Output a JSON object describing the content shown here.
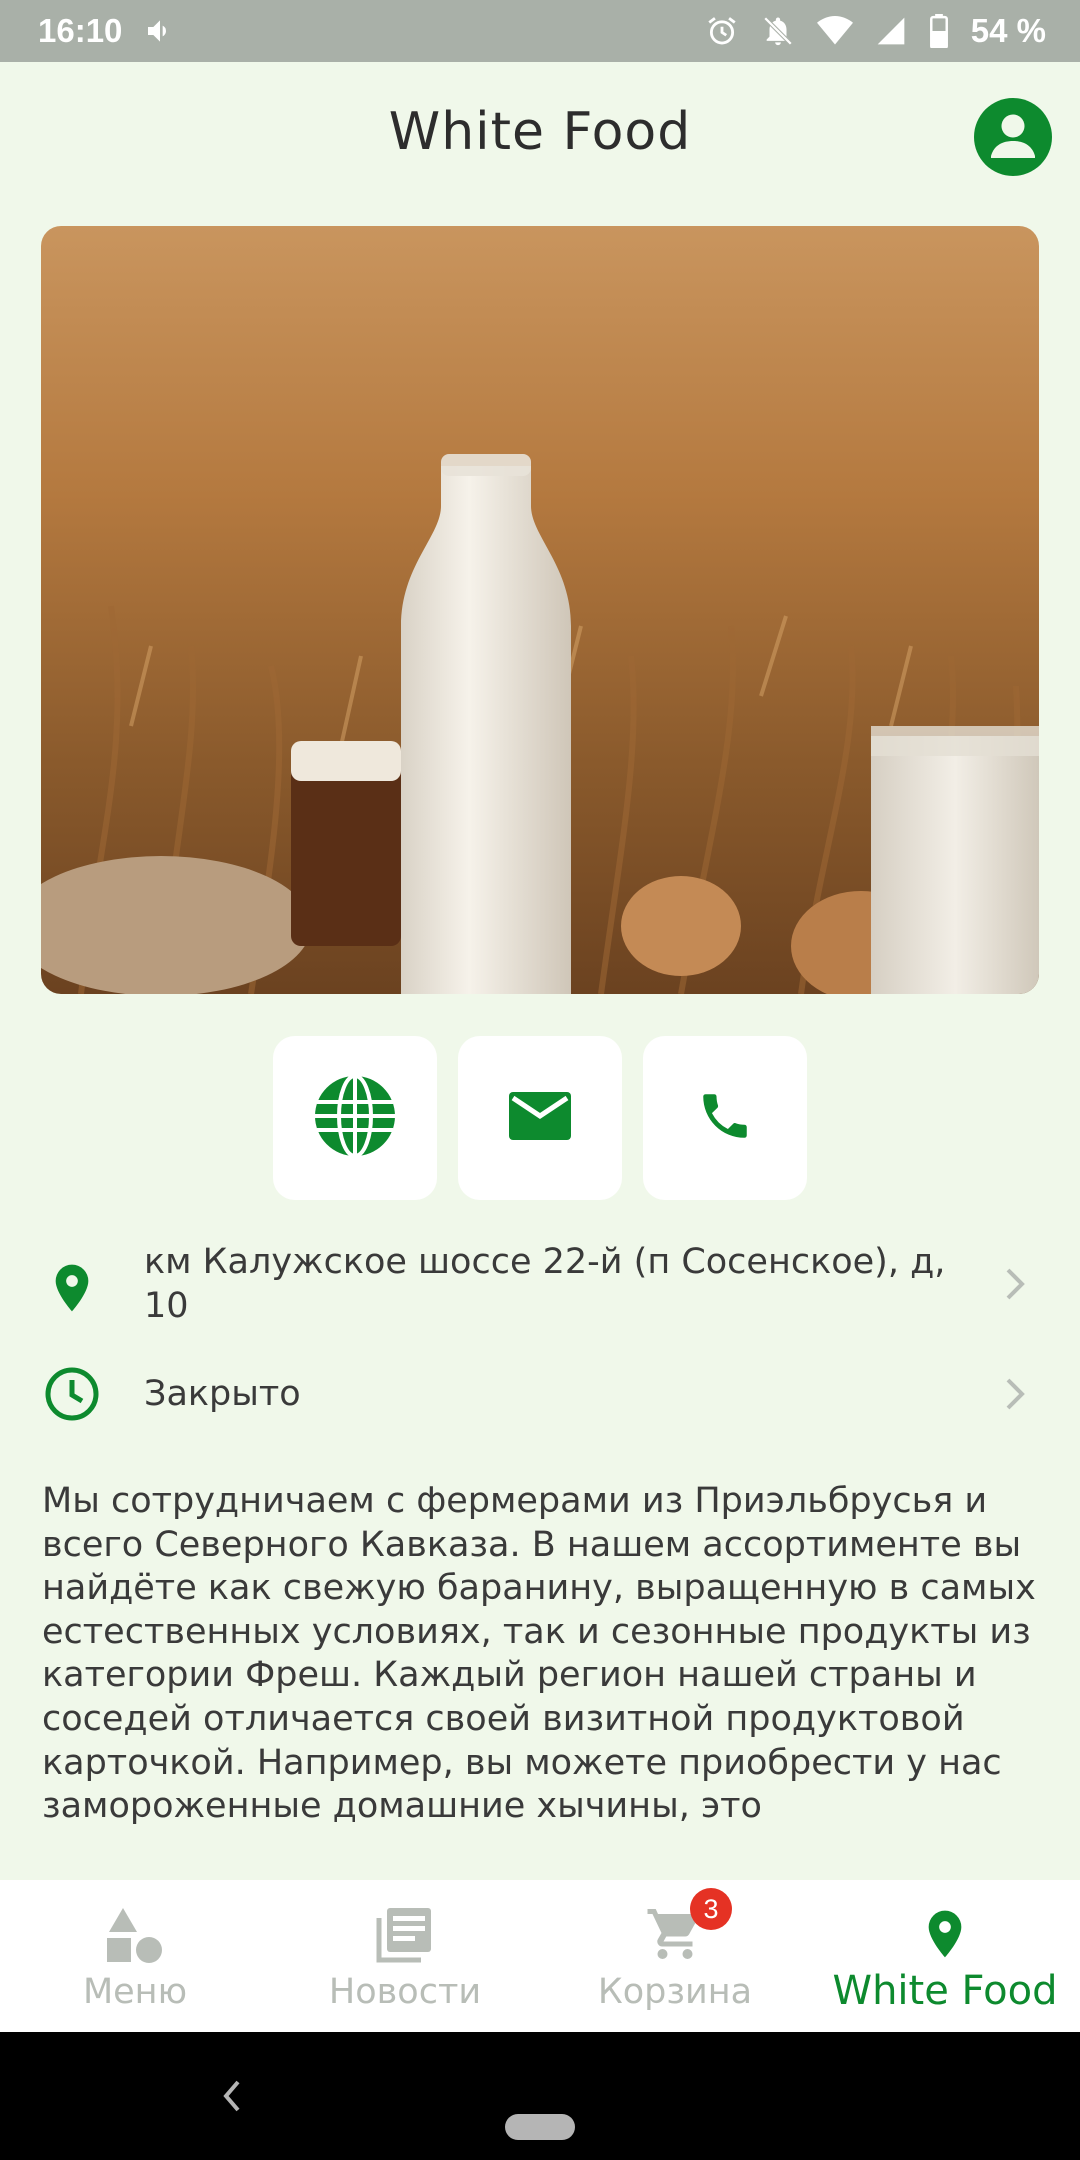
{
  "status_bar": {
    "time": "16:10",
    "battery": "54 %",
    "icons": [
      "volume-icon",
      "alarm-icon",
      "mute-icon",
      "wifi-icon",
      "signal-icon",
      "battery-icon"
    ]
  },
  "header": {
    "title": "White Food",
    "profile_icon": "account-circle-icon"
  },
  "hero": {
    "image": "milk-bottle-wheat-photo"
  },
  "contacts": [
    {
      "name": "website",
      "icon": "globe-icon"
    },
    {
      "name": "email",
      "icon": "mail-icon"
    },
    {
      "name": "phone",
      "icon": "phone-icon"
    }
  ],
  "info": {
    "address": "км Калужское шоссе 22-й (п Сосенское), д, 10",
    "hours": "Закрыто"
  },
  "description": "Мы сотрудничаем с фермерами из Приэльбрусья и всего Северного Кавказа. В нашем ассортименте вы найдёте как свежую баранину, выращенную в самых естественных условиях, так и сезонные продукты из категории Фреш. Каждый регион нашей страны и соседей отличается своей визитной продуктовой карточкой. Например, вы можете приобрести у нас замороженные домашние хычины, это",
  "bottom_nav": {
    "items": [
      {
        "label": "Меню",
        "icon": "shapes-icon",
        "active": false
      },
      {
        "label": "Новости",
        "icon": "news-icon",
        "active": false
      },
      {
        "label": "Корзина",
        "icon": "cart-icon",
        "active": false
      },
      {
        "label": "White Food",
        "icon": "location-pin-icon",
        "active": true
      }
    ],
    "cart_badge": "3"
  },
  "colors": {
    "accent": "#0d8a2e",
    "background": "#f0f8ea",
    "inactive": "#b8bdb7",
    "badge": "#e53224"
  }
}
